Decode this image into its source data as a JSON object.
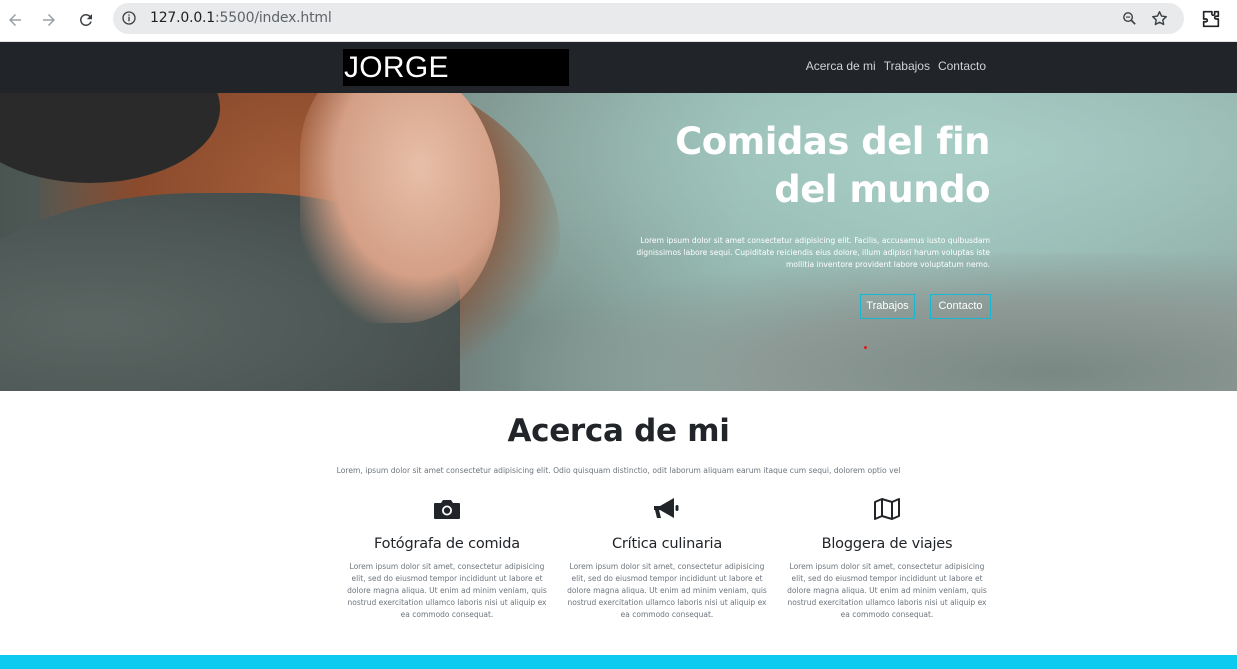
{
  "browser": {
    "url_host": "127.0.0.1",
    "url_rest": ":5500/index.html"
  },
  "navbar": {
    "brand": "JORGE MEDINA",
    "links": [
      "Acerca de mi",
      "Trabajos",
      "Contacto"
    ]
  },
  "hero": {
    "title_line1": "Comidas del fin",
    "title_line2": "del mundo",
    "text": "Lorem ipsum dolor sit amet consectetur adipisicing elit. Facilis, accusamus iusto quibusdam dignissimos labore sequi. Cupiditate reiciendis eius dolore, illum adipisci harum voluptas iste mollitia inventore provident labore voluptatum nemo.",
    "buttons": [
      "Trabajos",
      "Contacto"
    ],
    "accent_color": "#17b8d6"
  },
  "about": {
    "title": "Acerca de mi",
    "subtitle": "Lorem, ipsum dolor sit amet consectetur adipisicing elit. Odio quisquam distinctio, odit laborum aliquam earum itaque cum sequi, dolorem optio vel",
    "columns": [
      {
        "icon": "camera-icon",
        "title": "Fotógrafa de comida",
        "text": "Lorem ipsum dolor sit amet, consectetur adipisicing elit, sed do eiusmod tempor incididunt ut labore et dolore magna aliqua. Ut enim ad minim veniam, quis nostrud exercitation ullamco laboris nisi ut aliquip ex ea commodo consequat."
      },
      {
        "icon": "megaphone-icon",
        "title": "Crítica culinaria",
        "text": "Lorem ipsum dolor sit amet, consectetur adipisicing elit, sed do eiusmod tempor incididunt ut labore et dolore magna aliqua. Ut enim ad minim veniam, quis nostrud exercitation ullamco laboris nisi ut aliquip ex ea commodo consequat."
      },
      {
        "icon": "map-icon",
        "title": "Bloggera de viajes",
        "text": "Lorem ipsum dolor sit amet, consectetur adipisicing elit, sed do eiusmod tempor incididunt ut labore et dolore magna aliqua. Ut enim ad minim veniam, quis nostrud exercitation ullamco laboris nisi ut aliquip ex ea commodo consequat."
      }
    ]
  },
  "footer": {
    "color": "#0dcaf0"
  }
}
